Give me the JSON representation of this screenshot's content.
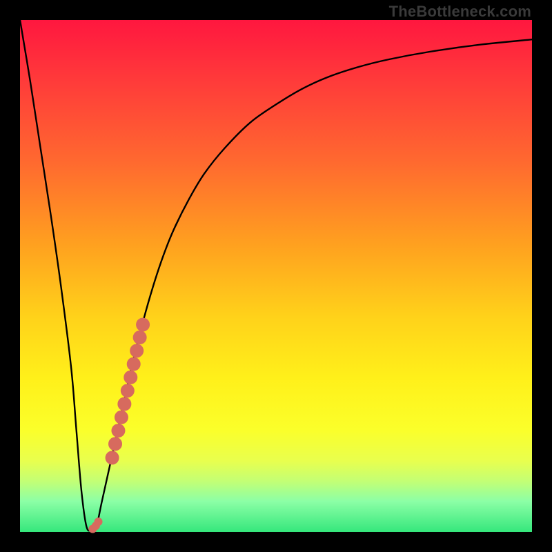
{
  "watermark": "TheBottleneck.com",
  "colors": {
    "curve_stroke": "#000000",
    "marker_fill": "#d76a5e"
  },
  "chart_data": {
    "type": "line",
    "title": "",
    "xlabel": "",
    "ylabel": "",
    "xlim": [
      0,
      100
    ],
    "ylim": [
      0,
      100
    ],
    "grid": false,
    "curve": {
      "x": [
        0,
        2,
        4,
        6,
        8,
        10,
        11,
        12,
        13,
        14,
        15,
        16,
        18,
        20,
        22,
        24,
        26,
        28,
        30,
        33,
        36,
        40,
        45,
        50,
        55,
        60,
        66,
        72,
        80,
        90,
        100
      ],
      "y": [
        100,
        88,
        75,
        62,
        48,
        32,
        20,
        8,
        1,
        0.5,
        1.5,
        6,
        15,
        24,
        33,
        41,
        48,
        54,
        59,
        65,
        70,
        75,
        80,
        83.5,
        86.5,
        88.8,
        90.8,
        92.3,
        93.8,
        95.2,
        96.2
      ]
    },
    "markers": {
      "x": [
        14.2,
        14.8,
        15.3,
        18.0,
        18.6,
        19.2,
        19.8,
        20.4,
        21.0,
        21.6,
        22.2,
        22.8,
        23.4,
        24.0
      ],
      "y": [
        0.6,
        1.2,
        2.0,
        14.5,
        17.2,
        19.8,
        22.4,
        25.0,
        27.6,
        30.2,
        32.8,
        35.4,
        38.0,
        40.5
      ],
      "radius": [
        6,
        6,
        6,
        10,
        10,
        10,
        10,
        10,
        10,
        10,
        10,
        10,
        10,
        10
      ]
    }
  }
}
